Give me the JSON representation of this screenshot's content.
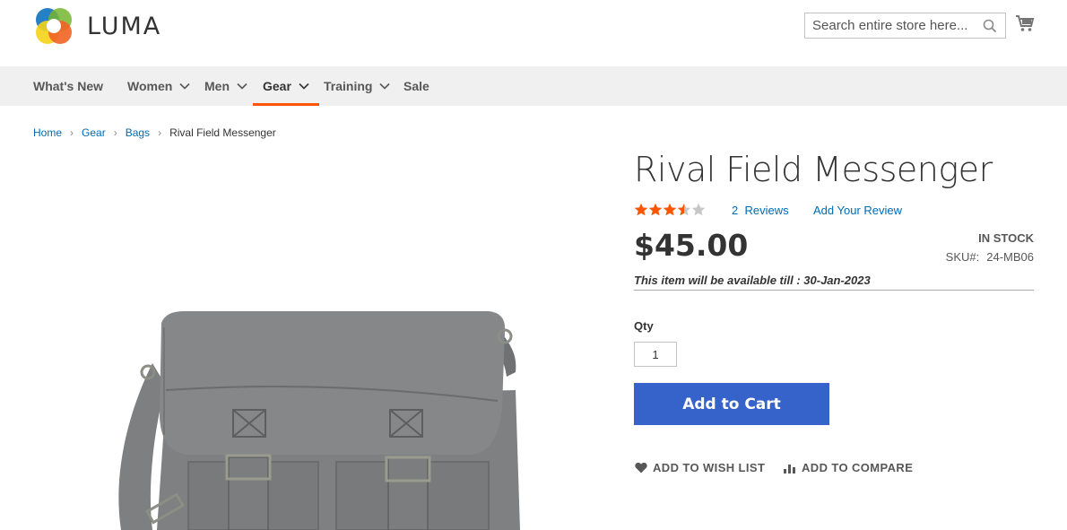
{
  "brand": {
    "name": "LUMA"
  },
  "search": {
    "placeholder": "Search entire store here..."
  },
  "nav": {
    "items": [
      {
        "label": "What's New",
        "has_menu": false
      },
      {
        "label": "Women",
        "has_menu": true
      },
      {
        "label": "Men",
        "has_menu": true
      },
      {
        "label": "Gear",
        "has_menu": true,
        "active": true
      },
      {
        "label": "Training",
        "has_menu": true
      },
      {
        "label": "Sale",
        "has_menu": false
      }
    ]
  },
  "breadcrumb": {
    "items": [
      "Home",
      "Gear",
      "Bags"
    ],
    "current": "Rival Field Messenger"
  },
  "product": {
    "title": "Rival Field Messenger",
    "rating_fraction": 0.7,
    "reviews_count": "2",
    "reviews_label": "Reviews",
    "add_review_label": "Add Your Review",
    "price": "$45.00",
    "stock": "In stock",
    "sku_label": "SKU#:",
    "sku": "24-MB06",
    "availability": "This item will be available till : 30-Jan-2023",
    "qty_label": "Qty",
    "qty_value": "1",
    "add_to_cart_label": "Add to Cart",
    "wishlist_label": "Add to Wish List",
    "compare_label": "Add to Compare"
  },
  "colors": {
    "accent": "#ff5501",
    "star": "#ff5501",
    "star_empty": "#c7c7c7",
    "link": "#006bb4",
    "button": "#3663c9",
    "nav_bg": "#f0f0f0"
  },
  "icons": {
    "search": "search-icon",
    "cart": "cart-icon",
    "wishlist": "heart-icon",
    "compare": "bar-chart-icon"
  }
}
